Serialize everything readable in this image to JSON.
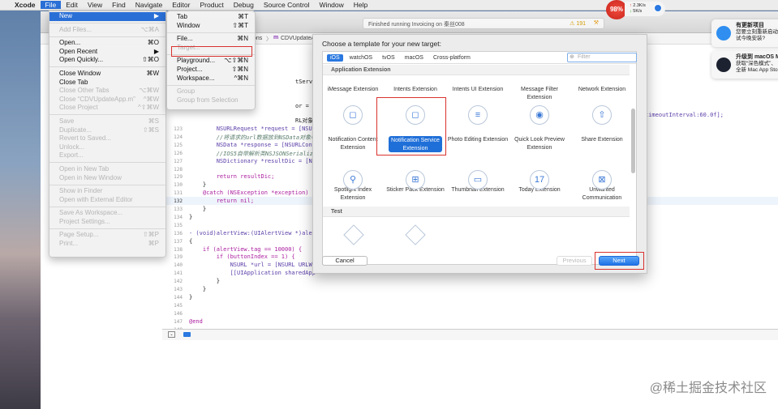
{
  "menubar": {
    "apple": "",
    "items": [
      "Xcode",
      "File",
      "Edit",
      "View",
      "Find",
      "Navigate",
      "Editor",
      "Product",
      "Debug",
      "Source Control",
      "Window",
      "Help"
    ],
    "active": "File"
  },
  "system": {
    "cpu": "98%",
    "net_up": "2.3K/s",
    "net_down": "5K/s"
  },
  "toolbar": {
    "status": "Finished running Invoicing on 秦丝008",
    "warnings": "191"
  },
  "jumpbar": {
    "crumbs": [
      "ons",
      "CDVUpdateAp"
    ]
  },
  "file_menu": {
    "items": [
      {
        "label": "New",
        "shortcut": "▶",
        "state": "selected"
      },
      {
        "sep": true
      },
      {
        "label": "Add Files...",
        "shortcut": "⌥⌘A",
        "state": "disabled"
      },
      {
        "sep": true
      },
      {
        "label": "Open...",
        "shortcut": "⌘O"
      },
      {
        "label": "Open Recent",
        "shortcut": "▶"
      },
      {
        "label": "Open Quickly...",
        "shortcut": "⇧⌘O"
      },
      {
        "sep": true
      },
      {
        "label": "Close Window",
        "shortcut": "⌘W"
      },
      {
        "label": "Close Tab",
        "shortcut": ""
      },
      {
        "label": "Close Other Tabs",
        "shortcut": "⌥⌘W",
        "state": "disabled"
      },
      {
        "label": "Close “CDVUpdateApp.m”",
        "shortcut": "^⌘W",
        "state": "disabled"
      },
      {
        "label": "Close Project",
        "shortcut": "^⇧⌘W",
        "state": "disabled"
      },
      {
        "sep": true
      },
      {
        "label": "Save",
        "shortcut": "⌘S",
        "state": "disabled"
      },
      {
        "label": "Duplicate...",
        "shortcut": "⇧⌘S",
        "state": "disabled"
      },
      {
        "label": "Revert to Saved...",
        "shortcut": "",
        "state": "disabled"
      },
      {
        "label": "Unlock...",
        "shortcut": "",
        "state": "disabled"
      },
      {
        "label": "Export...",
        "shortcut": "",
        "state": "disabled"
      },
      {
        "sep": true
      },
      {
        "label": "Open in New Tab",
        "shortcut": "",
        "state": "disabled"
      },
      {
        "label": "Open in New Window",
        "shortcut": "",
        "state": "disabled"
      },
      {
        "sep": true
      },
      {
        "label": "Show in Finder",
        "shortcut": "",
        "state": "disabled"
      },
      {
        "label": "Open with External Editor",
        "shortcut": "",
        "state": "disabled"
      },
      {
        "sep": true
      },
      {
        "label": "Save As Workspace...",
        "shortcut": "",
        "state": "disabled"
      },
      {
        "label": "Project Settings...",
        "shortcut": "",
        "state": "disabled"
      },
      {
        "sep": true
      },
      {
        "label": "Page Setup...",
        "shortcut": "⇧⌘P",
        "state": "disabled"
      },
      {
        "label": "Print...",
        "shortcut": "⌘P",
        "state": "disabled"
      }
    ]
  },
  "new_menu": {
    "items": [
      {
        "label": "Tab",
        "shortcut": "⌘T"
      },
      {
        "label": "Window",
        "shortcut": "⇧⌘T"
      },
      {
        "sep": true
      },
      {
        "label": "File...",
        "shortcut": "⌘N"
      },
      {
        "label": "Target...",
        "shortcut": "",
        "state": "disabled"
      },
      {
        "sep": true
      },
      {
        "label": "Playground...",
        "shortcut": "⌥⇧⌘N"
      },
      {
        "label": "Project...",
        "shortcut": "⇧⌘N"
      },
      {
        "label": "Workspace...",
        "shortcut": "^⌘N"
      },
      {
        "sep": true
      },
      {
        "label": "Group",
        "shortcut": "",
        "state": "disabled"
      },
      {
        "label": "Group from Selection",
        "shortcut": "",
        "state": "disabled"
      }
    ]
  },
  "code": [
    {
      "n": "",
      "t": "tServerVersionCod",
      "x": 14,
      "y": 41
    },
    {
      "n": "",
      "t": "or = nil;",
      "x": 14,
      "y": 71
    },
    {
      "n": "",
      "t": "RL对象",
      "x": 14,
      "y": 88
    },
    {
      "n": "123",
      "t": "        NSURLRequest *request = [NSUR"
    },
    {
      "n": "124",
      "t": "        //将请求的url数据放到NSData对象中"
    },
    {
      "n": "125",
      "t": "        NSData *response = [NSURLConn"
    },
    {
      "n": "126",
      "t": "        //IOS5自带解析类NSJSONSerializ"
    },
    {
      "n": "127",
      "t": "        NSDictionary *resultDic = [NS"
    },
    {
      "n": "128",
      "t": ""
    },
    {
      "n": "129",
      "t": "        return resultDic;"
    },
    {
      "n": "130",
      "t": "    }"
    },
    {
      "n": "131",
      "t": "    @catch (NSException *exception) {"
    },
    {
      "n": "132",
      "t": "        return nil;"
    },
    {
      "n": "133",
      "t": "    }"
    },
    {
      "n": "134",
      "t": "}"
    },
    {
      "n": "135",
      "t": ""
    },
    {
      "n": "136",
      "t": "- (void)alertView:(UIAlertView *)aler"
    },
    {
      "n": "137",
      "t": "{"
    },
    {
      "n": "138",
      "t": "    if (alertView.tag == 10000) {"
    },
    {
      "n": "139",
      "t": "        if (buttonIndex == 1) {"
    },
    {
      "n": "140",
      "t": "            NSURL *url = [NSURL URLWi"
    },
    {
      "n": "141",
      "t": "            [[UIApplication sharedApp"
    },
    {
      "n": "142",
      "t": "        }"
    },
    {
      "n": "143",
      "t": "    }"
    },
    {
      "n": "144",
      "t": "}"
    },
    {
      "n": "145",
      "t": ""
    },
    {
      "n": "146",
      "t": ""
    },
    {
      "n": "147",
      "t": "@end"
    },
    {
      "n": "148",
      "t": ""
    }
  ],
  "code_right": "timeoutInterval:60.0f];",
  "dialog": {
    "title": "Choose a template for your new target:",
    "tabs": [
      "iOS",
      "watchOS",
      "tvOS",
      "macOS",
      "Cross-platform"
    ],
    "active_tab": "iOS",
    "filter_placeholder": "Filter",
    "section1": "Application Extension",
    "templates": [
      {
        "label": "iMessage Extension",
        "icon": "imessage-extension-icon",
        "glyph": "◻"
      },
      {
        "label": "Intents Extension",
        "icon": "intents-extension-icon",
        "glyph": ""
      },
      {
        "label": "Intents UI Extension",
        "icon": "intents-ui-extension-icon",
        "glyph": "≡"
      },
      {
        "label": "Message Filter Extension",
        "icon": "message-filter-extension-icon",
        "glyph": "◉"
      },
      {
        "label": "Network Extension",
        "icon": "network-extension-icon",
        "glyph": "⇧"
      },
      {
        "label": "Notification Content Extension",
        "icon": "notification-content-icon",
        "glyph": "◻"
      },
      {
        "label": "Notification Service Extension",
        "icon": "notification-service-icon",
        "glyph": "◻",
        "selected": true
      },
      {
        "label": "Photo Editing Extension",
        "icon": "photo-editing-icon",
        "glyph": "☰"
      },
      {
        "label": "Quick Look Preview Extension",
        "icon": "quick-look-icon",
        "glyph": "◉"
      },
      {
        "label": "Share Extension",
        "icon": "share-extension-icon",
        "glyph": "⇧"
      },
      {
        "label": "Spotlight Index Extension",
        "icon": "spotlight-icon",
        "glyph": "⚲"
      },
      {
        "label": "Sticker Pack Extension",
        "icon": "sticker-pack-icon",
        "glyph": "⊞"
      },
      {
        "label": "Thumbnail Extension",
        "icon": "thumbnail-icon",
        "glyph": "▭"
      },
      {
        "label": "Today Extension",
        "icon": "today-extension-icon",
        "glyph": "17"
      },
      {
        "label": "Unwanted Communication",
        "icon": "unwanted-communication-icon",
        "glyph": "⊠"
      }
    ],
    "section2": "Test",
    "cancel": "Cancel",
    "previous": "Previous",
    "next": "Next"
  },
  "notifications": [
    {
      "title": "有更新项目",
      "body1": "您要立刻重新启动",
      "body2": "试今晚安装?",
      "color": "#2f8ef0"
    },
    {
      "title": "升级到 macOS M",
      "body1": "获取“深色模式”、",
      "body2": "全新 Mac App Sto",
      "color": "#1c2230"
    }
  ],
  "watermark": "@稀土掘金技术社区",
  "colors": {
    "accent": "#2a6fd6",
    "highlight_box": "#d9322e"
  }
}
